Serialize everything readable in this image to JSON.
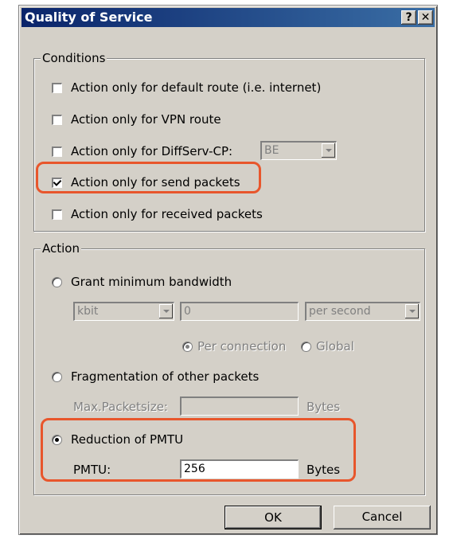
{
  "window": {
    "title": "Quality of Service",
    "help_button": "?",
    "close_button": "✕"
  },
  "conditions": {
    "legend": "Conditions",
    "items": [
      {
        "label": "Action only for default route (i.e. internet)",
        "checked": false
      },
      {
        "label": "Action only for VPN route",
        "checked": false
      },
      {
        "label": "Action only for DiffServ-CP:",
        "checked": false
      },
      {
        "label": "Action only for send packets",
        "checked": true
      },
      {
        "label": "Action only for received packets",
        "checked": false
      }
    ],
    "diffserv_value": "BE"
  },
  "action": {
    "legend": "Action",
    "grant": {
      "label": "Grant minimum bandwidth",
      "unit": "kbit",
      "amount": "0",
      "period": "per second",
      "per_connection": "Per connection",
      "global": "Global"
    },
    "fragmentation": {
      "label": "Fragmentation of other packets",
      "maxsize_label": "Max.Packetsize:",
      "maxsize_value": "",
      "bytes": "Bytes"
    },
    "pmtu": {
      "label": "Reduction of PMTU",
      "field_label": "PMTU:",
      "value": "256",
      "bytes": "Bytes"
    }
  },
  "buttons": {
    "ok": "OK",
    "cancel": "Cancel"
  },
  "colors": {
    "highlight": "#e8562c",
    "titlebar": "#0a246a"
  }
}
